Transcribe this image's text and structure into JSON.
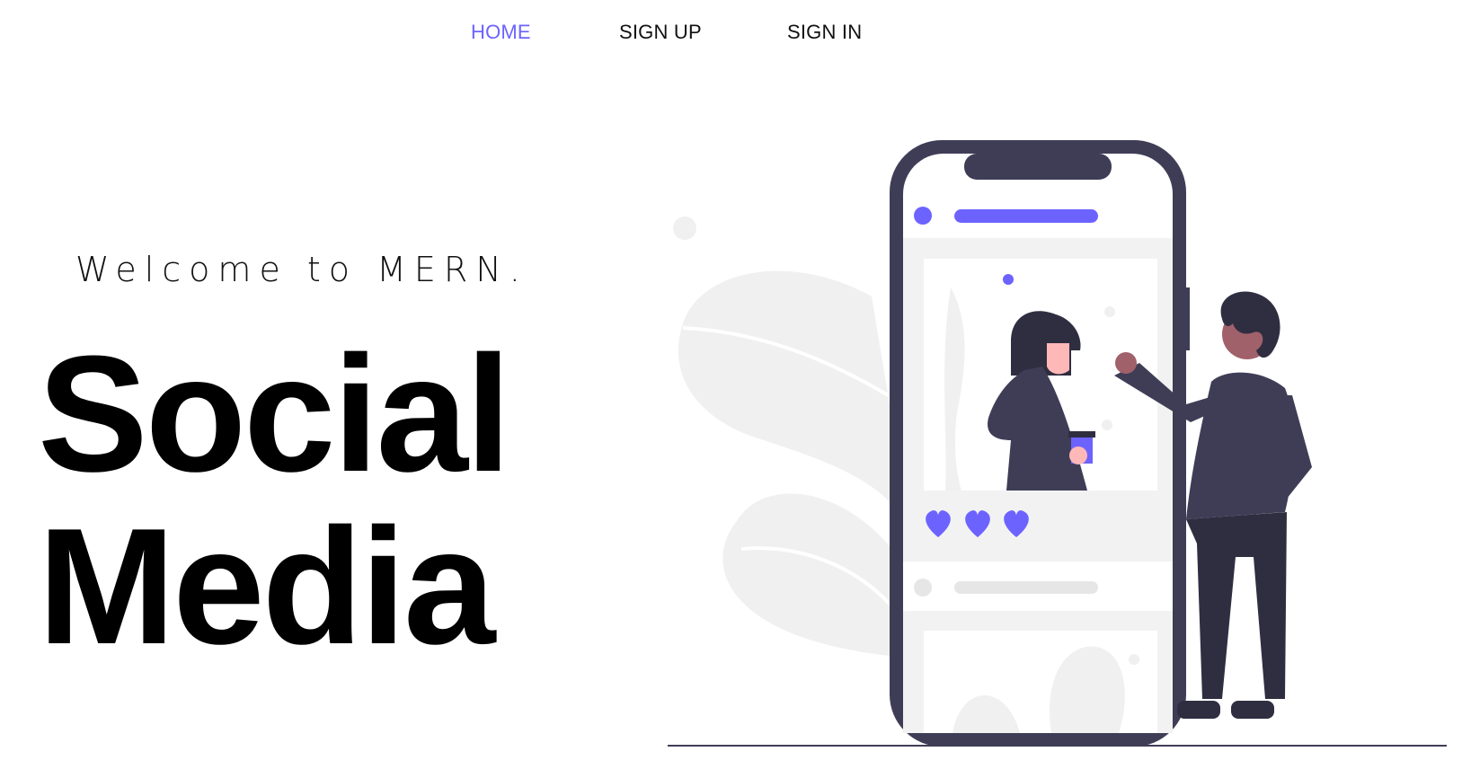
{
  "nav": {
    "items": [
      {
        "label": "HOME",
        "active": true
      },
      {
        "label": "SIGN UP",
        "active": false
      },
      {
        "label": "SIGN IN",
        "active": false
      }
    ]
  },
  "hero": {
    "welcome": "Welcome to MERN.",
    "title_line1": "Social",
    "title_line2": "Media"
  },
  "colors": {
    "accent": "#6c63ff",
    "dark": "#3f3d56",
    "light_gray": "#f0f0f0",
    "text": "#111111"
  },
  "illustration": {
    "icon": "person-with-smartphone-illustration",
    "likes": 3
  }
}
